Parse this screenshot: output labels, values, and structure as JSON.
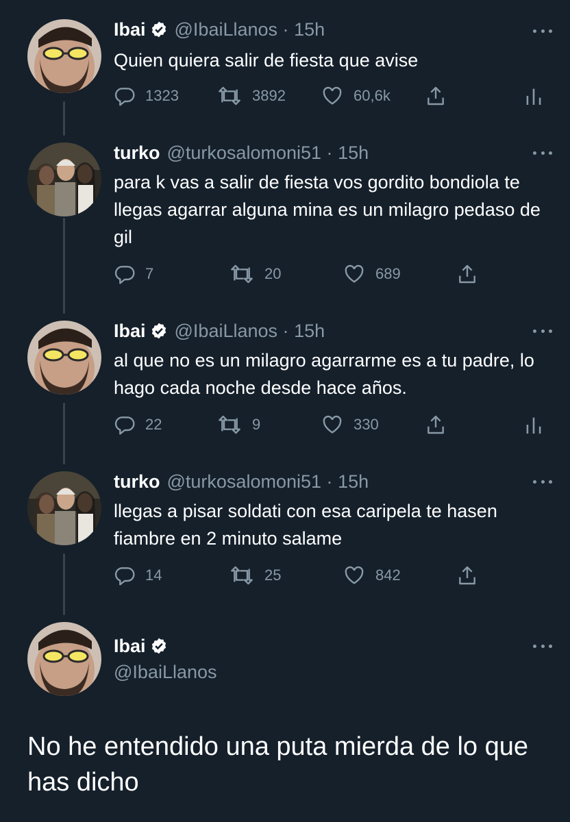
{
  "colors": {
    "background": "#15202b",
    "text": "#ffffff",
    "muted": "#8899a6",
    "thread_line": "#38444d"
  },
  "tweets": [
    {
      "name": "Ibai",
      "verified": true,
      "handle": "@IbaiLlanos",
      "dot": "·",
      "time": "15h",
      "text": "Quien quiera salir de fiesta que avise",
      "replies": "1323",
      "retweets": "3892",
      "likes": "60,6k",
      "analytics": true
    },
    {
      "name": "turko",
      "verified": false,
      "handle": "@turkosalomoni51",
      "dot": "·",
      "time": "15h",
      "text": "para k vas a salir de fiesta vos gordito bondiola te llegas agarrar alguna mina es un milagro pedaso de gil",
      "replies": "7",
      "retweets": "20",
      "likes": "689",
      "analytics": false
    },
    {
      "name": "Ibai",
      "verified": true,
      "handle": "@IbaiLlanos",
      "dot": "·",
      "time": "15h",
      "text": "al que no es un milagro agarrarme es a tu padre, lo hago cada noche desde hace años.",
      "replies": "22",
      "retweets": "9",
      "likes": "330",
      "analytics": true
    },
    {
      "name": "turko",
      "verified": false,
      "handle": "@turkosalomoni51",
      "dot": "·",
      "time": "15h",
      "text": "llegas a pisar soldati con esa caripela te hasen fiambre en 2 minuto salame",
      "replies": "14",
      "retweets": "25",
      "likes": "842",
      "analytics": false
    }
  ],
  "final_tweet": {
    "name": "Ibai",
    "verified": true,
    "handle": "@IbaiLlanos",
    "text": "No he entendido una puta mierda de lo que has dicho"
  }
}
